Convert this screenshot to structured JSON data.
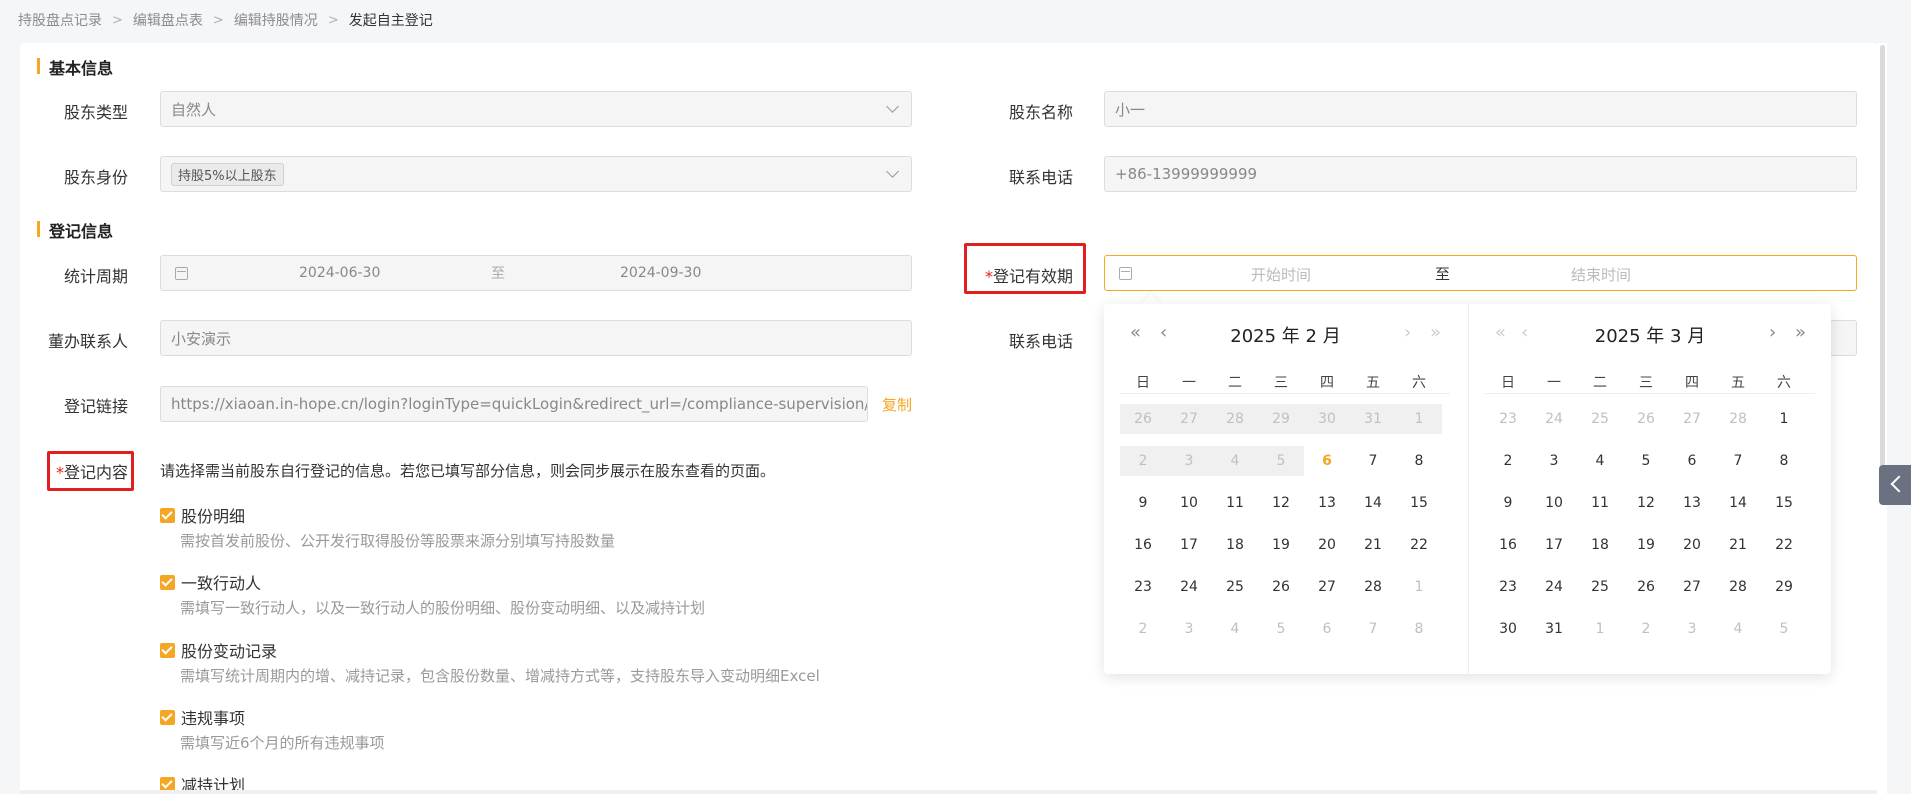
{
  "breadcrumb": [
    "持股盘点记录",
    "编辑盘点表",
    "编辑持股情况",
    "发起自主登记"
  ],
  "sections": {
    "basic": "基本信息",
    "register": "登记信息"
  },
  "basic": {
    "shareholder_type_label": "股东类型",
    "shareholder_type_value": "自然人",
    "shareholder_name_label": "股东名称",
    "shareholder_name_value": "小一",
    "identity_label": "股东身份",
    "identity_tag": "持股5%以上股东",
    "phone_label": "联系电话",
    "phone_value": "+86-13999999999"
  },
  "register": {
    "period_label": "统计周期",
    "period_start": "2024-06-30",
    "period_sep": "至",
    "period_end": "2024-09-30",
    "validity_required": "*",
    "validity_label": "登记有效期",
    "validity_start_placeholder": "开始时间",
    "validity_sep": "至",
    "validity_end_placeholder": "结束时间",
    "contact_label": "董办联系人",
    "contact_value": "小安演示",
    "contact_phone_label": "联系电话",
    "link_label": "登记链接",
    "link_value": "https://xiaoan.in-hope.cn/login?loginType=quickLogin&redirect_url=/compliance-supervision/registe",
    "copy_label": "复制",
    "content_required": "*",
    "content_label": "登记内容",
    "content_desc": "请选择需当前股东自行登记的信息。若您已填写部分信息，则会同步展示在股东查看的页面。",
    "items": [
      {
        "title": "股份明细",
        "desc": "需按首发前股份、公开发行取得股份等股票来源分别填写持股数量"
      },
      {
        "title": "一致行动人",
        "desc": "需填写一致行动人，以及一致行动人的股份明细、股份变动明细、以及减持计划"
      },
      {
        "title": "股份变动记录",
        "desc": "需填写统计周期内的增、减持记录，包含股份数量、增减持方式等，支持股东导入变动明细Excel"
      },
      {
        "title": "违规事项",
        "desc": "需填写近6个月的所有违规事项"
      },
      {
        "title": "减持计划",
        "desc": ""
      }
    ]
  },
  "picker": {
    "weekdays": [
      "日",
      "一",
      "二",
      "三",
      "四",
      "五",
      "六"
    ],
    "nav": {
      "prev_year": "«",
      "prev_month": "‹",
      "next_month": "›",
      "next_year": "»"
    },
    "left_title": "2025 年 2 月",
    "right_title": "2025 年 3 月",
    "left_days": [
      [
        "26",
        "27",
        "28",
        "29",
        "30",
        "31",
        "1"
      ],
      [
        "2",
        "3",
        "4",
        "5",
        "6",
        "7",
        "8"
      ],
      [
        "9",
        "10",
        "11",
        "12",
        "13",
        "14",
        "15"
      ],
      [
        "16",
        "17",
        "18",
        "19",
        "20",
        "21",
        "22"
      ],
      [
        "23",
        "24",
        "25",
        "26",
        "27",
        "28",
        "1"
      ],
      [
        "2",
        "3",
        "4",
        "5",
        "6",
        "7",
        "8"
      ]
    ],
    "right_days": [
      [
        "23",
        "24",
        "25",
        "26",
        "27",
        "28",
        "1"
      ],
      [
        "2",
        "3",
        "4",
        "5",
        "6",
        "7",
        "8"
      ],
      [
        "9",
        "10",
        "11",
        "12",
        "13",
        "14",
        "15"
      ],
      [
        "16",
        "17",
        "18",
        "19",
        "20",
        "21",
        "22"
      ],
      [
        "23",
        "24",
        "25",
        "26",
        "27",
        "28",
        "29"
      ],
      [
        "30",
        "31",
        "1",
        "2",
        "3",
        "4",
        "5"
      ]
    ],
    "today": "6"
  },
  "colors": {
    "accent": "#f5a623",
    "highlight": "#e21e1e"
  }
}
